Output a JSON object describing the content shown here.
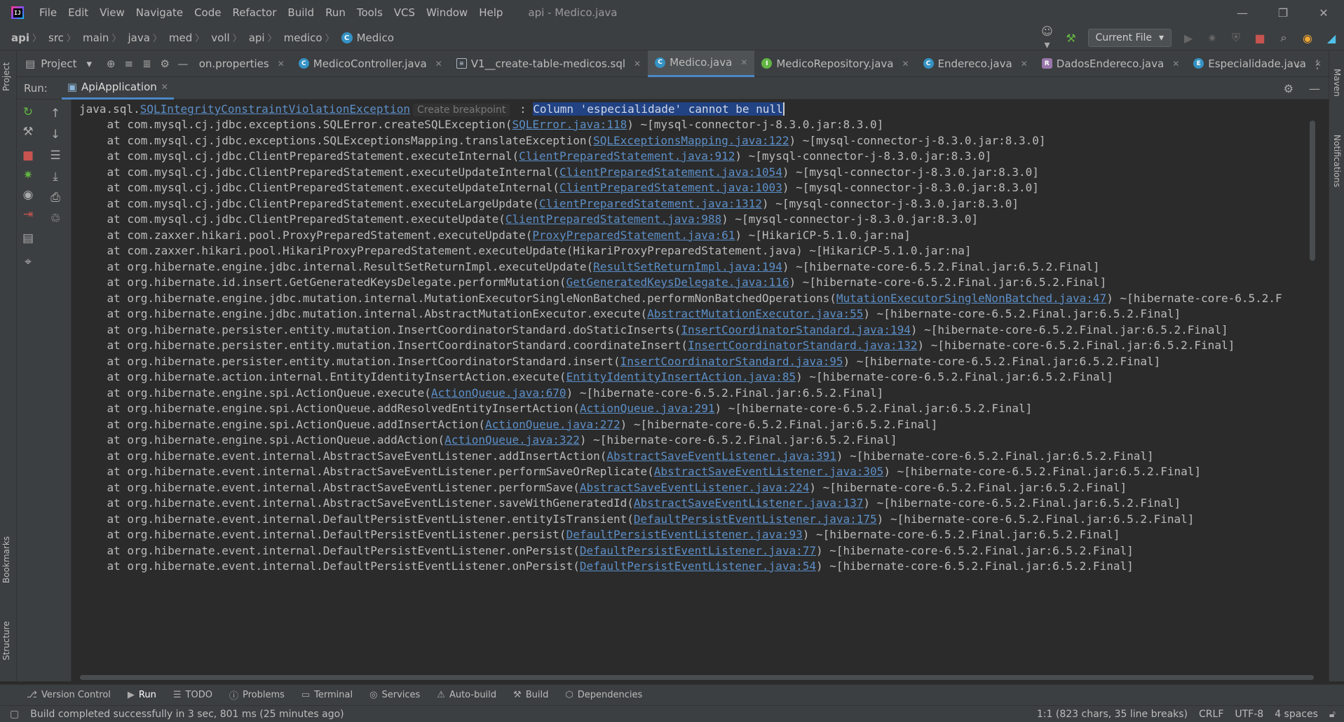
{
  "menu": [
    "File",
    "Edit",
    "View",
    "Navigate",
    "Code",
    "Refactor",
    "Build",
    "Run",
    "Tools",
    "VCS",
    "Window",
    "Help"
  ],
  "window_title": "api - Medico.java",
  "breadcrumbs": [
    "api",
    "src",
    "main",
    "java",
    "med",
    "voll",
    "api",
    "medico",
    "Medico"
  ],
  "run_config": "Current File",
  "project_label": "Project",
  "tabs": [
    {
      "label": "on.properties",
      "icon": "properties-icon",
      "active": false
    },
    {
      "label": "MedicoController.java",
      "icon": "class-icon",
      "active": false
    },
    {
      "label": "V1__create-table-medicos.sql",
      "icon": "sql-icon",
      "active": false
    },
    {
      "label": "Medico.java",
      "icon": "class-icon",
      "active": true
    },
    {
      "label": "MedicoRepository.java",
      "icon": "interface-icon",
      "active": false
    },
    {
      "label": "Endereco.java",
      "icon": "class-icon",
      "active": false
    },
    {
      "label": "DadosEndereco.java",
      "icon": "record-icon",
      "active": false
    },
    {
      "label": "Especialidade.java",
      "icon": "class-icon",
      "active": false
    }
  ],
  "run": {
    "label": "Run:",
    "tab": "ApiApplication"
  },
  "console": {
    "exception": {
      "prefix": "java.sql.",
      "class": "SQLIntegrityConstraintViolationException",
      "hint": "Create breakpoint",
      "sep": " : ",
      "message": "Column 'especialidade' cannot be null"
    },
    "frames": [
      {
        "pre": "at com.mysql.cj.jdbc.exceptions.SQLError.createSQLException(",
        "link": "SQLError.java:118",
        "post": ") ~[mysql-connector-j-8.3.0.jar:8.3.0]"
      },
      {
        "pre": "at com.mysql.cj.jdbc.exceptions.SQLExceptionsMapping.translateException(",
        "link": "SQLExceptionsMapping.java:122",
        "post": ") ~[mysql-connector-j-8.3.0.jar:8.3.0]"
      },
      {
        "pre": "at com.mysql.cj.jdbc.ClientPreparedStatement.executeInternal(",
        "link": "ClientPreparedStatement.java:912",
        "post": ") ~[mysql-connector-j-8.3.0.jar:8.3.0]"
      },
      {
        "pre": "at com.mysql.cj.jdbc.ClientPreparedStatement.executeUpdateInternal(",
        "link": "ClientPreparedStatement.java:1054",
        "post": ") ~[mysql-connector-j-8.3.0.jar:8.3.0]"
      },
      {
        "pre": "at com.mysql.cj.jdbc.ClientPreparedStatement.executeUpdateInternal(",
        "link": "ClientPreparedStatement.java:1003",
        "post": ") ~[mysql-connector-j-8.3.0.jar:8.3.0]"
      },
      {
        "pre": "at com.mysql.cj.jdbc.ClientPreparedStatement.executeLargeUpdate(",
        "link": "ClientPreparedStatement.java:1312",
        "post": ") ~[mysql-connector-j-8.3.0.jar:8.3.0]"
      },
      {
        "pre": "at com.mysql.cj.jdbc.ClientPreparedStatement.executeUpdate(",
        "link": "ClientPreparedStatement.java:988",
        "post": ") ~[mysql-connector-j-8.3.0.jar:8.3.0]"
      },
      {
        "pre": "at com.zaxxer.hikari.pool.ProxyPreparedStatement.executeUpdate(",
        "link": "ProxyPreparedStatement.java:61",
        "post": ") ~[HikariCP-5.1.0.jar:na]"
      },
      {
        "pre": "at com.zaxxer.hikari.pool.HikariProxyPreparedStatement.executeUpdate(HikariProxyPreparedStatement.java) ~[HikariCP-5.1.0.jar:na]",
        "link": "",
        "post": ""
      },
      {
        "pre": "at org.hibernate.engine.jdbc.internal.ResultSetReturnImpl.executeUpdate(",
        "link": "ResultSetReturnImpl.java:194",
        "post": ") ~[hibernate-core-6.5.2.Final.jar:6.5.2.Final]"
      },
      {
        "pre": "at org.hibernate.id.insert.GetGeneratedKeysDelegate.performMutation(",
        "link": "GetGeneratedKeysDelegate.java:116",
        "post": ") ~[hibernate-core-6.5.2.Final.jar:6.5.2.Final]"
      },
      {
        "pre": "at org.hibernate.engine.jdbc.mutation.internal.MutationExecutorSingleNonBatched.performNonBatchedOperations(",
        "link": "MutationExecutorSingleNonBatched.java:47",
        "post": ") ~[hibernate-core-6.5.2.F"
      },
      {
        "pre": "at org.hibernate.engine.jdbc.mutation.internal.AbstractMutationExecutor.execute(",
        "link": "AbstractMutationExecutor.java:55",
        "post": ") ~[hibernate-core-6.5.2.Final.jar:6.5.2.Final]"
      },
      {
        "pre": "at org.hibernate.persister.entity.mutation.InsertCoordinatorStandard.doStaticInserts(",
        "link": "InsertCoordinatorStandard.java:194",
        "post": ") ~[hibernate-core-6.5.2.Final.jar:6.5.2.Final]"
      },
      {
        "pre": "at org.hibernate.persister.entity.mutation.InsertCoordinatorStandard.coordinateInsert(",
        "link": "InsertCoordinatorStandard.java:132",
        "post": ") ~[hibernate-core-6.5.2.Final.jar:6.5.2.Final]"
      },
      {
        "pre": "at org.hibernate.persister.entity.mutation.InsertCoordinatorStandard.insert(",
        "link": "InsertCoordinatorStandard.java:95",
        "post": ") ~[hibernate-core-6.5.2.Final.jar:6.5.2.Final]"
      },
      {
        "pre": "at org.hibernate.action.internal.EntityIdentityInsertAction.execute(",
        "link": "EntityIdentityInsertAction.java:85",
        "post": ") ~[hibernate-core-6.5.2.Final.jar:6.5.2.Final]"
      },
      {
        "pre": "at org.hibernate.engine.spi.ActionQueue.execute(",
        "link": "ActionQueue.java:670",
        "post": ") ~[hibernate-core-6.5.2.Final.jar:6.5.2.Final]"
      },
      {
        "pre": "at org.hibernate.engine.spi.ActionQueue.addResolvedEntityInsertAction(",
        "link": "ActionQueue.java:291",
        "post": ") ~[hibernate-core-6.5.2.Final.jar:6.5.2.Final]"
      },
      {
        "pre": "at org.hibernate.engine.spi.ActionQueue.addInsertAction(",
        "link": "ActionQueue.java:272",
        "post": ") ~[hibernate-core-6.5.2.Final.jar:6.5.2.Final]"
      },
      {
        "pre": "at org.hibernate.engine.spi.ActionQueue.addAction(",
        "link": "ActionQueue.java:322",
        "post": ") ~[hibernate-core-6.5.2.Final.jar:6.5.2.Final]"
      },
      {
        "pre": "at org.hibernate.event.internal.AbstractSaveEventListener.addInsertAction(",
        "link": "AbstractSaveEventListener.java:391",
        "post": ") ~[hibernate-core-6.5.2.Final.jar:6.5.2.Final]"
      },
      {
        "pre": "at org.hibernate.event.internal.AbstractSaveEventListener.performSaveOrReplicate(",
        "link": "AbstractSaveEventListener.java:305",
        "post": ") ~[hibernate-core-6.5.2.Final.jar:6.5.2.Final]"
      },
      {
        "pre": "at org.hibernate.event.internal.AbstractSaveEventListener.performSave(",
        "link": "AbstractSaveEventListener.java:224",
        "post": ") ~[hibernate-core-6.5.2.Final.jar:6.5.2.Final]"
      },
      {
        "pre": "at org.hibernate.event.internal.AbstractSaveEventListener.saveWithGeneratedId(",
        "link": "AbstractSaveEventListener.java:137",
        "post": ") ~[hibernate-core-6.5.2.Final.jar:6.5.2.Final]"
      },
      {
        "pre": "at org.hibernate.event.internal.DefaultPersistEventListener.entityIsTransient(",
        "link": "DefaultPersistEventListener.java:175",
        "post": ") ~[hibernate-core-6.5.2.Final.jar:6.5.2.Final]"
      },
      {
        "pre": "at org.hibernate.event.internal.DefaultPersistEventListener.persist(",
        "link": "DefaultPersistEventListener.java:93",
        "post": ") ~[hibernate-core-6.5.2.Final.jar:6.5.2.Final]"
      },
      {
        "pre": "at org.hibernate.event.internal.DefaultPersistEventListener.onPersist(",
        "link": "DefaultPersistEventListener.java:77",
        "post": ") ~[hibernate-core-6.5.2.Final.jar:6.5.2.Final]"
      },
      {
        "pre": "at org.hibernate.event.internal.DefaultPersistEventListener.onPersist(",
        "link": "DefaultPersistEventListener.java:54",
        "post": ") ~[hibernate-core-6.5.2.Final.jar:6.5.2.Final]"
      }
    ]
  },
  "side_tabs": {
    "left": [
      "Project",
      "Bookmarks",
      "Structure"
    ],
    "right": [
      "Maven",
      "Notifications"
    ]
  },
  "bottom_tools": [
    {
      "label": "Version Control",
      "icon": "git-branch-icon"
    },
    {
      "label": "Run",
      "icon": "run-icon",
      "active": true
    },
    {
      "label": "TODO",
      "icon": "list-icon"
    },
    {
      "label": "Problems",
      "icon": "problems-icon"
    },
    {
      "label": "Terminal",
      "icon": "terminal-icon"
    },
    {
      "label": "Services",
      "icon": "services-icon"
    },
    {
      "label": "Auto-build",
      "icon": "warning-icon"
    },
    {
      "label": "Build",
      "icon": "hammer-icon"
    },
    {
      "label": "Dependencies",
      "icon": "dependencies-icon"
    }
  ],
  "status": {
    "message": "Build completed successfully in 3 sec, 801 ms (25 minutes ago)",
    "position": "1:1 (823 chars, 35 line breaks)",
    "line_sep": "CRLF",
    "encoding": "UTF-8",
    "indent": "4 spaces"
  },
  "colors": {
    "accent": "#4a88c7",
    "link": "#5c8fc8",
    "selection": "#214283",
    "stop": "#c75450"
  }
}
